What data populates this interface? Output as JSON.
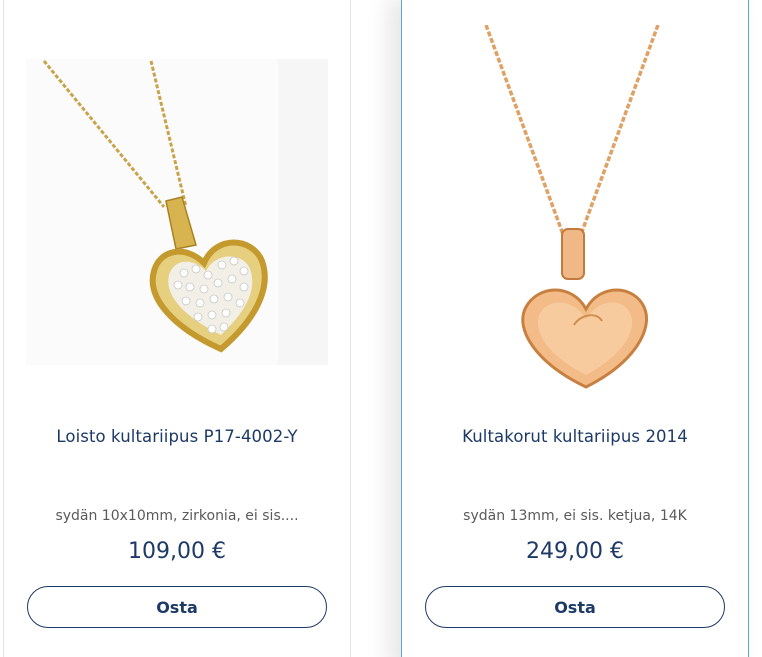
{
  "products": [
    {
      "title": "Loisto kultariipus P17-4002-Y",
      "description": "sydän 10x10mm, zirkonia, ei sis....",
      "price": "109,00 €",
      "buy_label": "Osta",
      "image_icon": "heart-pendant-zirconia-icon"
    },
    {
      "title": "Kultakorut kultariipus 2014",
      "description": "sydän 13mm, ei sis. ketjua, 14K",
      "price": "249,00 €",
      "buy_label": "Osta",
      "image_icon": "heart-pendant-gold-icon"
    }
  ],
  "colors": {
    "brand": "#1d3a66",
    "active_border": "#54aec9",
    "gold": "#d9b24a",
    "rose_gold": "#e8a468"
  }
}
